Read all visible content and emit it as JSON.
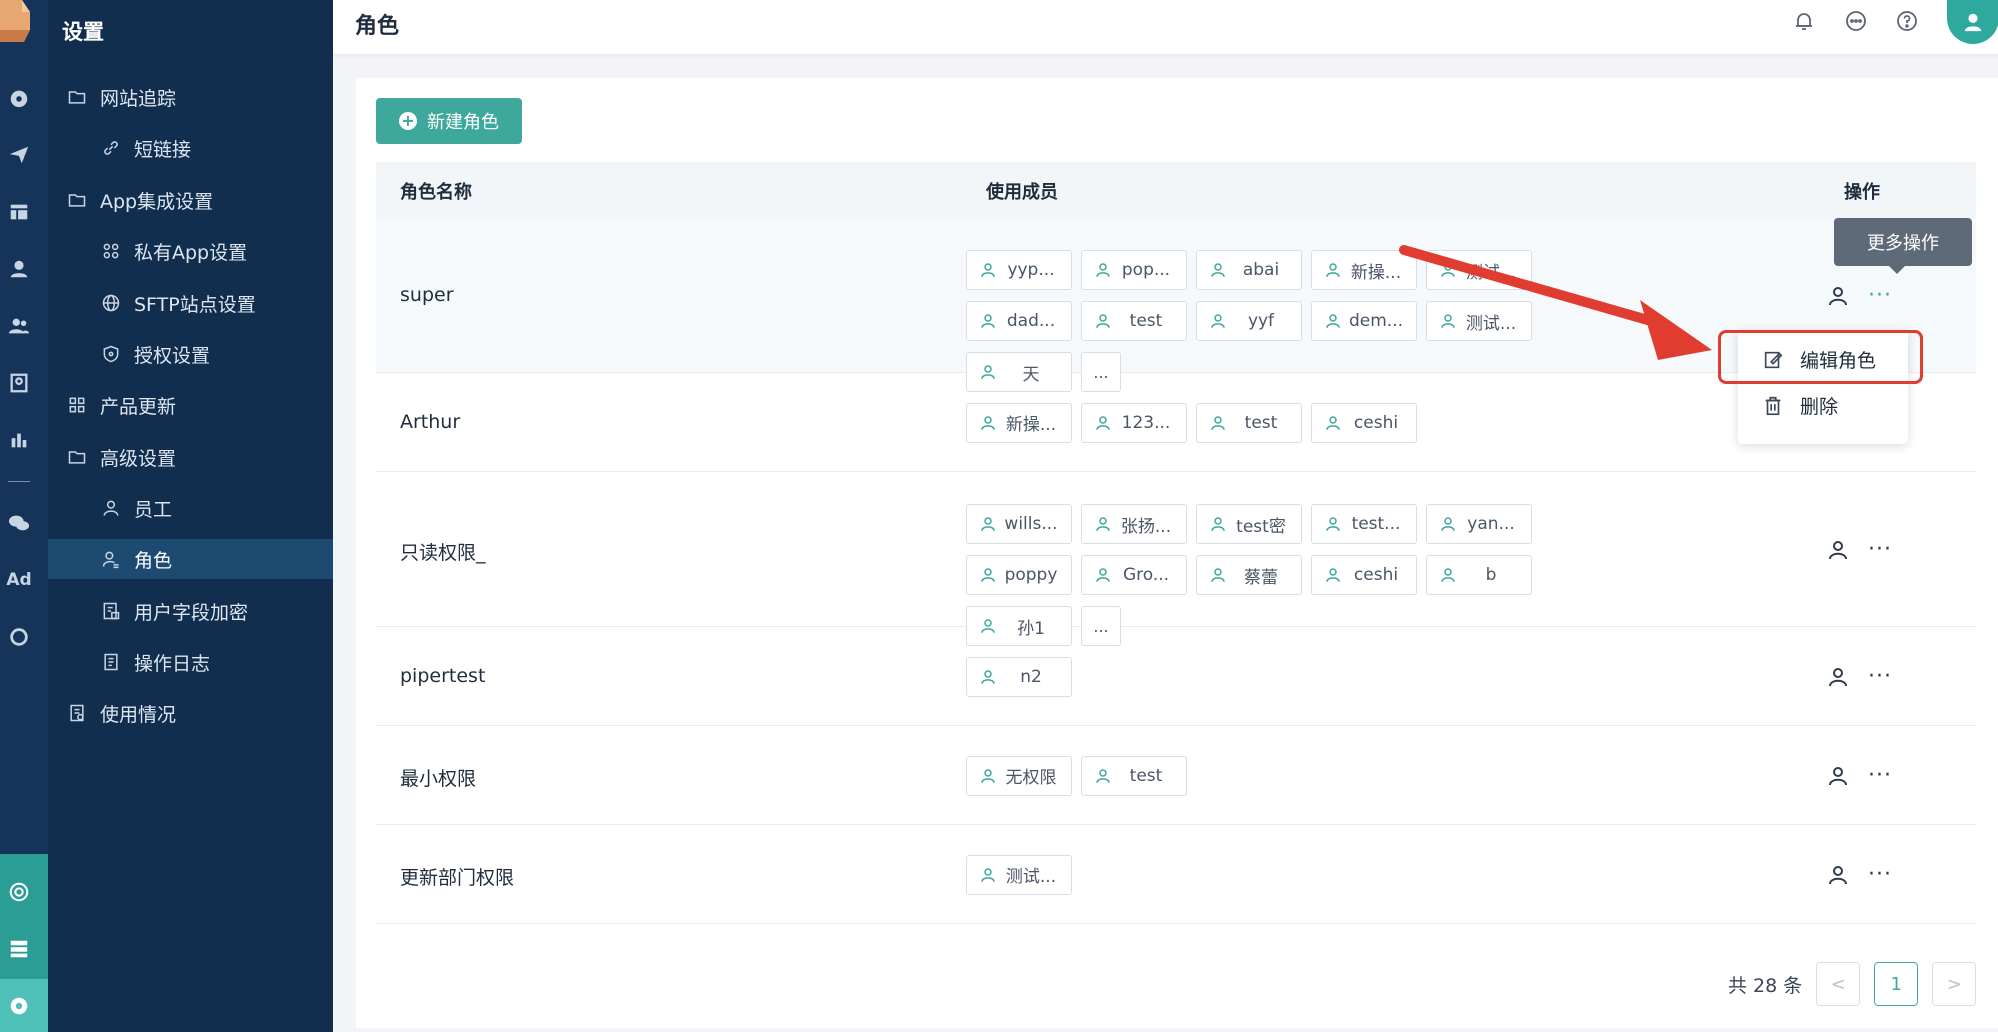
{
  "sidebar": {
    "title": "设置",
    "items": [
      {
        "label": "网站追踪",
        "icon": "folder-icon"
      },
      {
        "label": "短链接",
        "icon": "link-icon"
      },
      {
        "label": "App集成设置",
        "icon": "folder-icon"
      },
      {
        "label": "私有App设置",
        "icon": "apps-icon"
      },
      {
        "label": "SFTP站点设置",
        "icon": "globe-icon"
      },
      {
        "label": "授权设置",
        "icon": "shield-icon"
      },
      {
        "label": "产品更新",
        "icon": "grid-icon"
      },
      {
        "label": "高级设置",
        "icon": "folder-icon"
      },
      {
        "label": "员工",
        "icon": "user-icon"
      },
      {
        "label": "角色",
        "icon": "user-role-icon"
      },
      {
        "label": "用户字段加密",
        "icon": "encrypt-icon"
      },
      {
        "label": "操作日志",
        "icon": "log-icon"
      },
      {
        "label": "使用情况",
        "icon": "usage-icon"
      }
    ]
  },
  "rail": {
    "ad_label": "Ad"
  },
  "header": {
    "title": "角色"
  },
  "toolbar": {
    "new_role_label": "新建角色"
  },
  "table": {
    "columns": {
      "name": "角色名称",
      "members": "使用成员",
      "actions": "操作"
    },
    "rows": [
      {
        "name": "super",
        "members": [
          "yyp...",
          "pop...",
          "abai",
          "新操...",
          "测试...",
          "dad...",
          "test",
          "yyf",
          "dem...",
          "测试...",
          "天"
        ],
        "more": "..."
      },
      {
        "name": "Arthur",
        "members": [
          "新操...",
          "123...",
          "test",
          "ceshi"
        ],
        "more": ""
      },
      {
        "name": "只读权限_",
        "members": [
          "wills...",
          "张扬...",
          "test密",
          "test...",
          "yan...",
          "poppy",
          "Gro...",
          "蔡蕾",
          "ceshi",
          "b",
          "孙1"
        ],
        "more": "..."
      },
      {
        "name": "pipertest",
        "members": [
          "n2"
        ],
        "more": ""
      },
      {
        "name": "最小权限",
        "members": [
          "无权限",
          "test"
        ],
        "more": ""
      },
      {
        "name": "更新部门权限",
        "members": [
          "测试..."
        ],
        "more": ""
      }
    ]
  },
  "tooltip": {
    "text": "更多操作"
  },
  "dropdown": {
    "edit_label": "编辑角色",
    "delete_label": "删除"
  },
  "pagination": {
    "total_label": "共 28 条",
    "current_page": "1",
    "prev": "<",
    "next": ">"
  },
  "colors": {
    "accent": "#3ea89c",
    "sidebar_bg": "#122e4f",
    "rail_bg": "#16345a",
    "highlight": "#e03c2f"
  }
}
